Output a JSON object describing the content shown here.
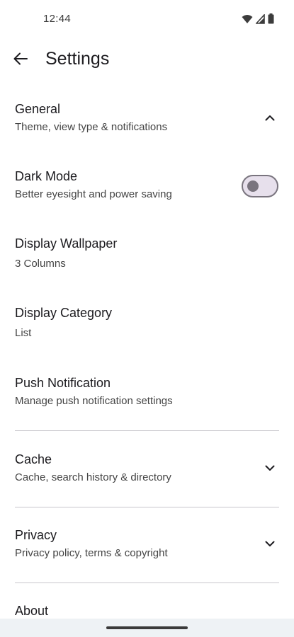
{
  "status_bar": {
    "time": "12:44",
    "icons": [
      "wifi-icon",
      "signal-icon",
      "battery-icon"
    ]
  },
  "app_bar": {
    "back_icon": "arrow-back-icon",
    "title": "Settings"
  },
  "settings": {
    "general": {
      "title": "General",
      "subtitle": "Theme, view type & notifications",
      "expanded": true
    },
    "dark_mode": {
      "title": "Dark Mode",
      "subtitle": "Better eyesight and power saving",
      "enabled": false
    },
    "display_wallpaper": {
      "title": "Display Wallpaper",
      "subtitle": "3 Columns"
    },
    "display_category": {
      "title": "Display Category",
      "subtitle": "List"
    },
    "push_notification": {
      "title": "Push Notification",
      "subtitle": "Manage push notification settings"
    },
    "cache": {
      "title": "Cache",
      "subtitle": "Cache, search history & directory",
      "expanded": false
    },
    "privacy": {
      "title": "Privacy",
      "subtitle": "Privacy policy, terms & copyright",
      "expanded": false
    },
    "about": {
      "title": "About"
    }
  },
  "colors": {
    "text_primary": "#1c1b1f",
    "text_secondary": "#444444",
    "divider": "#c8c6cc",
    "toggle_track": "#e7e0ec",
    "toggle_outline": "#79747e",
    "nav_bar": "#eef2f5"
  }
}
